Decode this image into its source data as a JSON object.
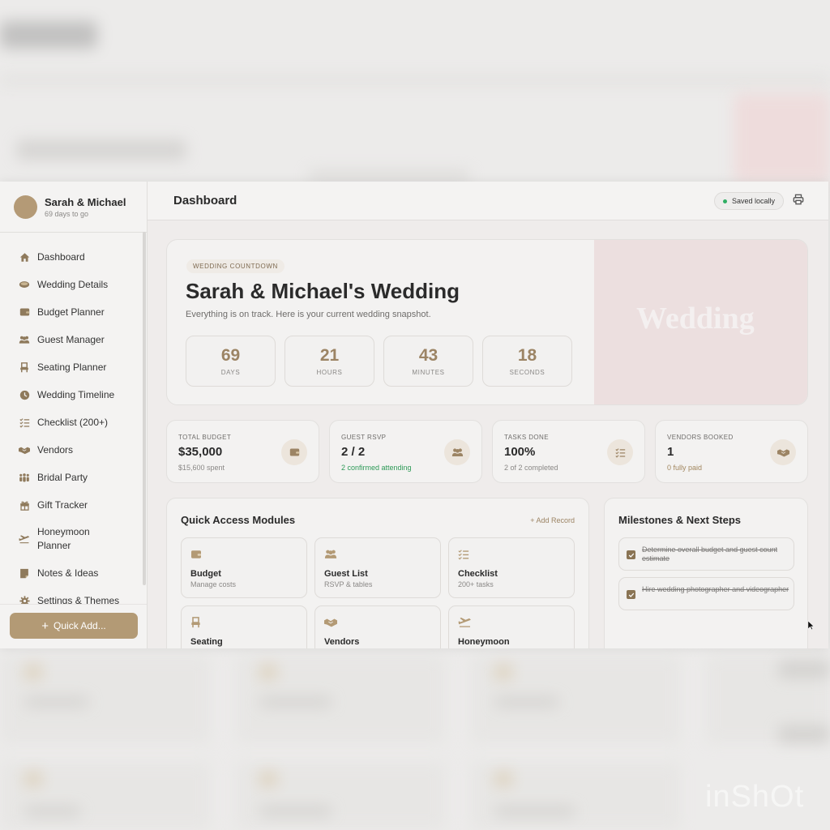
{
  "sidebar": {
    "couple_name": "Sarah & Michael",
    "days_to_go": "69 days to go",
    "items": [
      {
        "label": "Dashboard",
        "icon": "home-icon"
      },
      {
        "label": "Wedding Details",
        "icon": "rings-icon"
      },
      {
        "label": "Budget Planner",
        "icon": "wallet-icon"
      },
      {
        "label": "Guest Manager",
        "icon": "users-icon"
      },
      {
        "label": "Seating Planner",
        "icon": "chair-icon"
      },
      {
        "label": "Wedding Timeline",
        "icon": "clock-icon"
      },
      {
        "label": "Checklist (200+)",
        "icon": "checklist-icon"
      },
      {
        "label": "Vendors",
        "icon": "handshake-icon"
      },
      {
        "label": "Bridal Party",
        "icon": "group-icon"
      },
      {
        "label": "Gift Tracker",
        "icon": "gift-icon"
      },
      {
        "label": "Honeymoon Planner",
        "icon": "plane-icon"
      },
      {
        "label": "Notes & Ideas",
        "icon": "note-icon"
      },
      {
        "label": "Settings & Themes",
        "icon": "gear-icon"
      }
    ],
    "quick_add": "Quick Add..."
  },
  "topbar": {
    "title": "Dashboard",
    "saved_status": "Saved locally"
  },
  "hero": {
    "badge": "WEDDING COUNTDOWN",
    "title": "Sarah & Michael's Wedding",
    "subtitle": "Everything is on track. Here is your current wedding snapshot.",
    "image_text": "Wedding",
    "countdown": [
      {
        "value": "69",
        "label": "DAYS"
      },
      {
        "value": "21",
        "label": "HOURS"
      },
      {
        "value": "43",
        "label": "MINUTES"
      },
      {
        "value": "18",
        "label": "SECONDS"
      }
    ]
  },
  "stats": [
    {
      "label": "TOTAL BUDGET",
      "value": "$35,000",
      "sub": "$15,600 spent",
      "icon": "wallet-icon"
    },
    {
      "label": "GUEST RSVP",
      "value": "2 / 2",
      "sub": "2 confirmed attending",
      "icon": "users-icon"
    },
    {
      "label": "TASKS DONE",
      "value": "100%",
      "sub": "2 of 2 completed",
      "icon": "checklist-icon"
    },
    {
      "label": "VENDORS BOOKED",
      "value": "1",
      "sub": "0 fully paid",
      "icon": "handshake-icon"
    }
  ],
  "quick_access": {
    "title": "Quick Access Modules",
    "add_record": "+ Add Record",
    "modules": [
      {
        "name": "Budget",
        "desc": "Manage costs",
        "icon": "wallet-icon"
      },
      {
        "name": "Guest List",
        "desc": "RSVP & tables",
        "icon": "users-icon"
      },
      {
        "name": "Checklist",
        "desc": "200+ tasks",
        "icon": "checklist-icon"
      },
      {
        "name": "Seating",
        "desc": "",
        "icon": "chair-icon"
      },
      {
        "name": "Vendors",
        "desc": "",
        "icon": "handshake-icon"
      },
      {
        "name": "Honeymoon",
        "desc": "",
        "icon": "plane-icon"
      }
    ]
  },
  "milestones": {
    "title": "Milestones & Next Steps",
    "items": [
      {
        "text": "Determine overall budget and guest count estimate",
        "done": true
      },
      {
        "text": "Hire wedding photographer and videographer",
        "done": true
      }
    ]
  },
  "watermark": "inShOt",
  "colors": {
    "accent": "#b39a75",
    "accent_dark": "#8a7454",
    "success": "#2fae63",
    "hero_image": "#ecdfdf"
  }
}
